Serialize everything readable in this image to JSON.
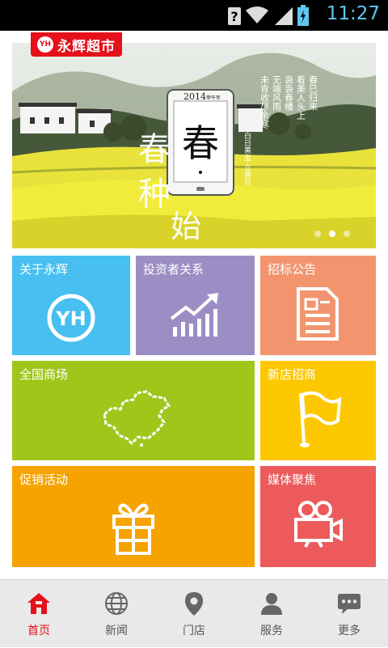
{
  "status_bar": {
    "time": "11:27",
    "icons": [
      "wifi-unknown-icon",
      "wifi-icon",
      "signal-icon",
      "battery-charging-icon"
    ]
  },
  "logo": {
    "mark": "YH",
    "text": "永辉超市"
  },
  "banner": {
    "year": "2014",
    "year_suffix": "甲午年",
    "main_char": "春",
    "side_chars": [
      "春",
      "种",
      "始"
    ],
    "poem_lines": [
      "春已归来",
      "看美人头上",
      "袅袅春幡",
      "无端风雨",
      "未肯收尽余寒"
    ],
    "sub_caption": "白日黄金·立春日",
    "carousel": {
      "count": 3,
      "active_index": 1
    }
  },
  "tiles": [
    {
      "label": "关于永辉",
      "color": "#47bff0",
      "icon": "yh-logo-icon",
      "icon_text": "YH"
    },
    {
      "label": "投资者关系",
      "color": "#9b8ec4",
      "icon": "rising-chart-icon"
    },
    {
      "label": "招标公告",
      "color": "#f2956f",
      "icon": "document-icon"
    },
    {
      "label": "全国商场",
      "color": "#a0c61c",
      "icon": "china-map-icon"
    },
    {
      "label": "新店招商",
      "color": "#fdc800",
      "icon": "flag-icon"
    },
    {
      "label": "促销活动",
      "color": "#f6a300",
      "icon": "gift-icon"
    },
    {
      "label": "媒体聚焦",
      "color": "#ec5a5c",
      "icon": "video-camera-icon"
    }
  ],
  "tabbar": {
    "active": 0,
    "items": [
      {
        "label": "首页",
        "icon": "home-icon"
      },
      {
        "label": "新闻",
        "icon": "globe-icon"
      },
      {
        "label": "门店",
        "icon": "location-pin-icon"
      },
      {
        "label": "服务",
        "icon": "person-icon"
      },
      {
        "label": "更多",
        "icon": "chat-bubble-icon"
      }
    ]
  },
  "colors": {
    "brand_red": "#e5101a",
    "status_time": "#5ec8ef",
    "tabbar_bg": "#e9e9e9"
  }
}
